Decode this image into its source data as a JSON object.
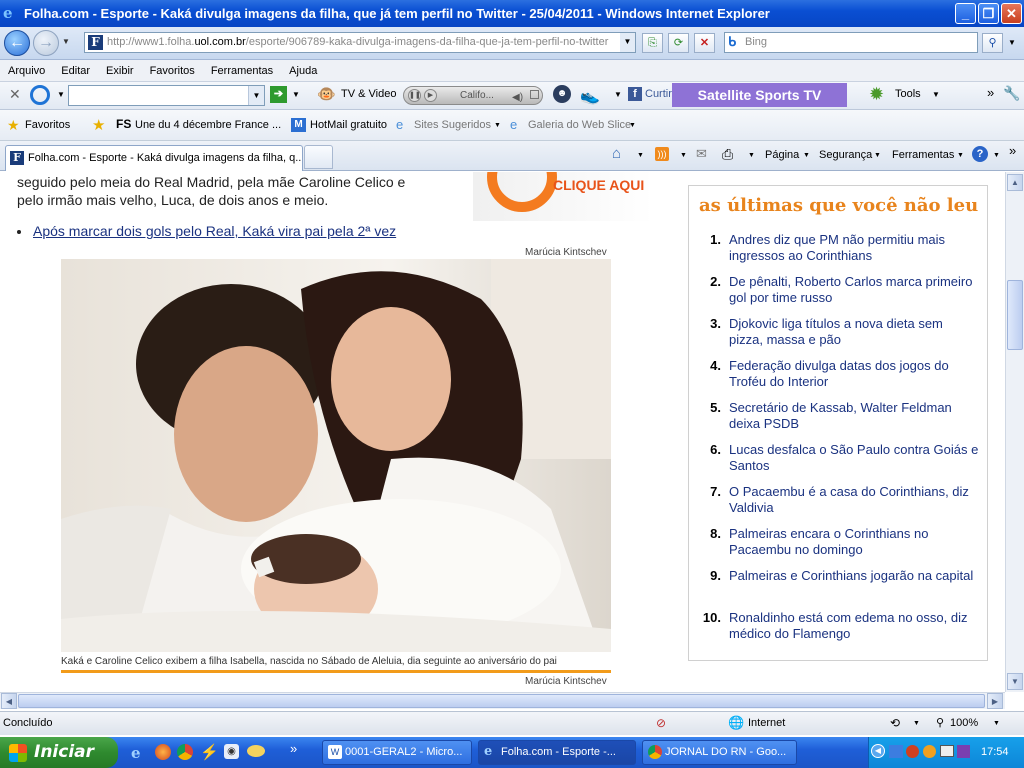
{
  "window": {
    "title": "Folha.com - Esporte - Kaká divulga imagens da filha, que já tem perfil no Twitter - 25/04/2011 - Windows Internet Explorer"
  },
  "address_bar": {
    "url_prefix": "http://www1.folha.",
    "url_domain": "uol.com.br",
    "url_path": "/esporte/906789-kaka-divulga-imagens-da-filha-que-ja-tem-perfil-no-twitter",
    "search_placeholder": "Bing"
  },
  "menu": [
    "Arquivo",
    "Editar",
    "Exibir",
    "Favoritos",
    "Ferramentas",
    "Ajuda"
  ],
  "toolbar": {
    "tv_video": "TV & Video",
    "media_track": "Califo...",
    "curtir": "Curtir",
    "satellite": "Satellite Sports TV",
    "tools": "Tools"
  },
  "favorites_bar": {
    "favorites": "Favoritos",
    "items": [
      "Une du 4 décembre  France ...",
      "HotMail gratuito",
      "Sites Sugeridos",
      "Galeria do Web Slice"
    ]
  },
  "tabs": {
    "active": "Folha.com - Esporte - Kaká divulga imagens da filha, q..."
  },
  "command_bar": {
    "pagina": "Página",
    "seguranca": "Segurança",
    "ferramentas": "Ferramentas"
  },
  "article": {
    "line1": "seguido pelo meia do Real Madrid, pela mãe Caroline Celico e",
    "line2": "pelo irmão mais velho, Luca, de dois anos e meio.",
    "ad_text": "CLIQUE AQUI",
    "related_link": "Após marcar dois gols pelo Real, Kaká vira pai pela 2ª vez",
    "photo_credit": "Marúcia Kintschev",
    "caption": "Kaká e Caroline Celico exibem a filha Isabella, nascida no Sábado de Aleluia, dia seguinte ao aniversário do pai",
    "photo_credit_2": "Marúcia Kintschev"
  },
  "sidebar": {
    "title": "as últimas que você não leu",
    "items": [
      {
        "n": "1.",
        "text": "Andres diz que PM não permitiu mais ingressos ao Corinthians"
      },
      {
        "n": "2.",
        "text": "De pênalti, Roberto Carlos marca primeiro gol por time russo"
      },
      {
        "n": "3.",
        "text": "Djokovic liga títulos a nova dieta sem pizza, massa e pão"
      },
      {
        "n": "4.",
        "text": "Federação divulga datas dos jogos do Troféu do Interior"
      },
      {
        "n": "5.",
        "text": "Secretário de Kassab, Walter Feldman deixa PSDB"
      },
      {
        "n": "6.",
        "text": "Lucas desfalca o São Paulo contra Goiás e Santos"
      },
      {
        "n": "7.",
        "text": "O Pacaembu é a casa do Corinthians, diz Valdivia"
      },
      {
        "n": "8.",
        "text": "Palmeiras encara o Corinthians no Pacaembu no domingo"
      },
      {
        "n": "9.",
        "text": "Palmeiras e Corinthians jogarão na capital"
      },
      {
        "n": "10.",
        "text": "Ronaldinho está com edema no osso, diz médico do Flamengo"
      }
    ]
  },
  "status_bar": {
    "status": "Concluído",
    "zone": "Internet",
    "zoom": "100%"
  },
  "taskbar": {
    "start": "Iniciar",
    "tasks": [
      "0001-GERAL2 - Micro...",
      "Folha.com - Esporte -...",
      "JORNAL DO RN - Goo..."
    ],
    "clock": "17:54"
  },
  "colors": {
    "accent_orange": "#e8841d",
    "link_blue": "#1a3280",
    "satellite_purple": "#8e72d6"
  }
}
